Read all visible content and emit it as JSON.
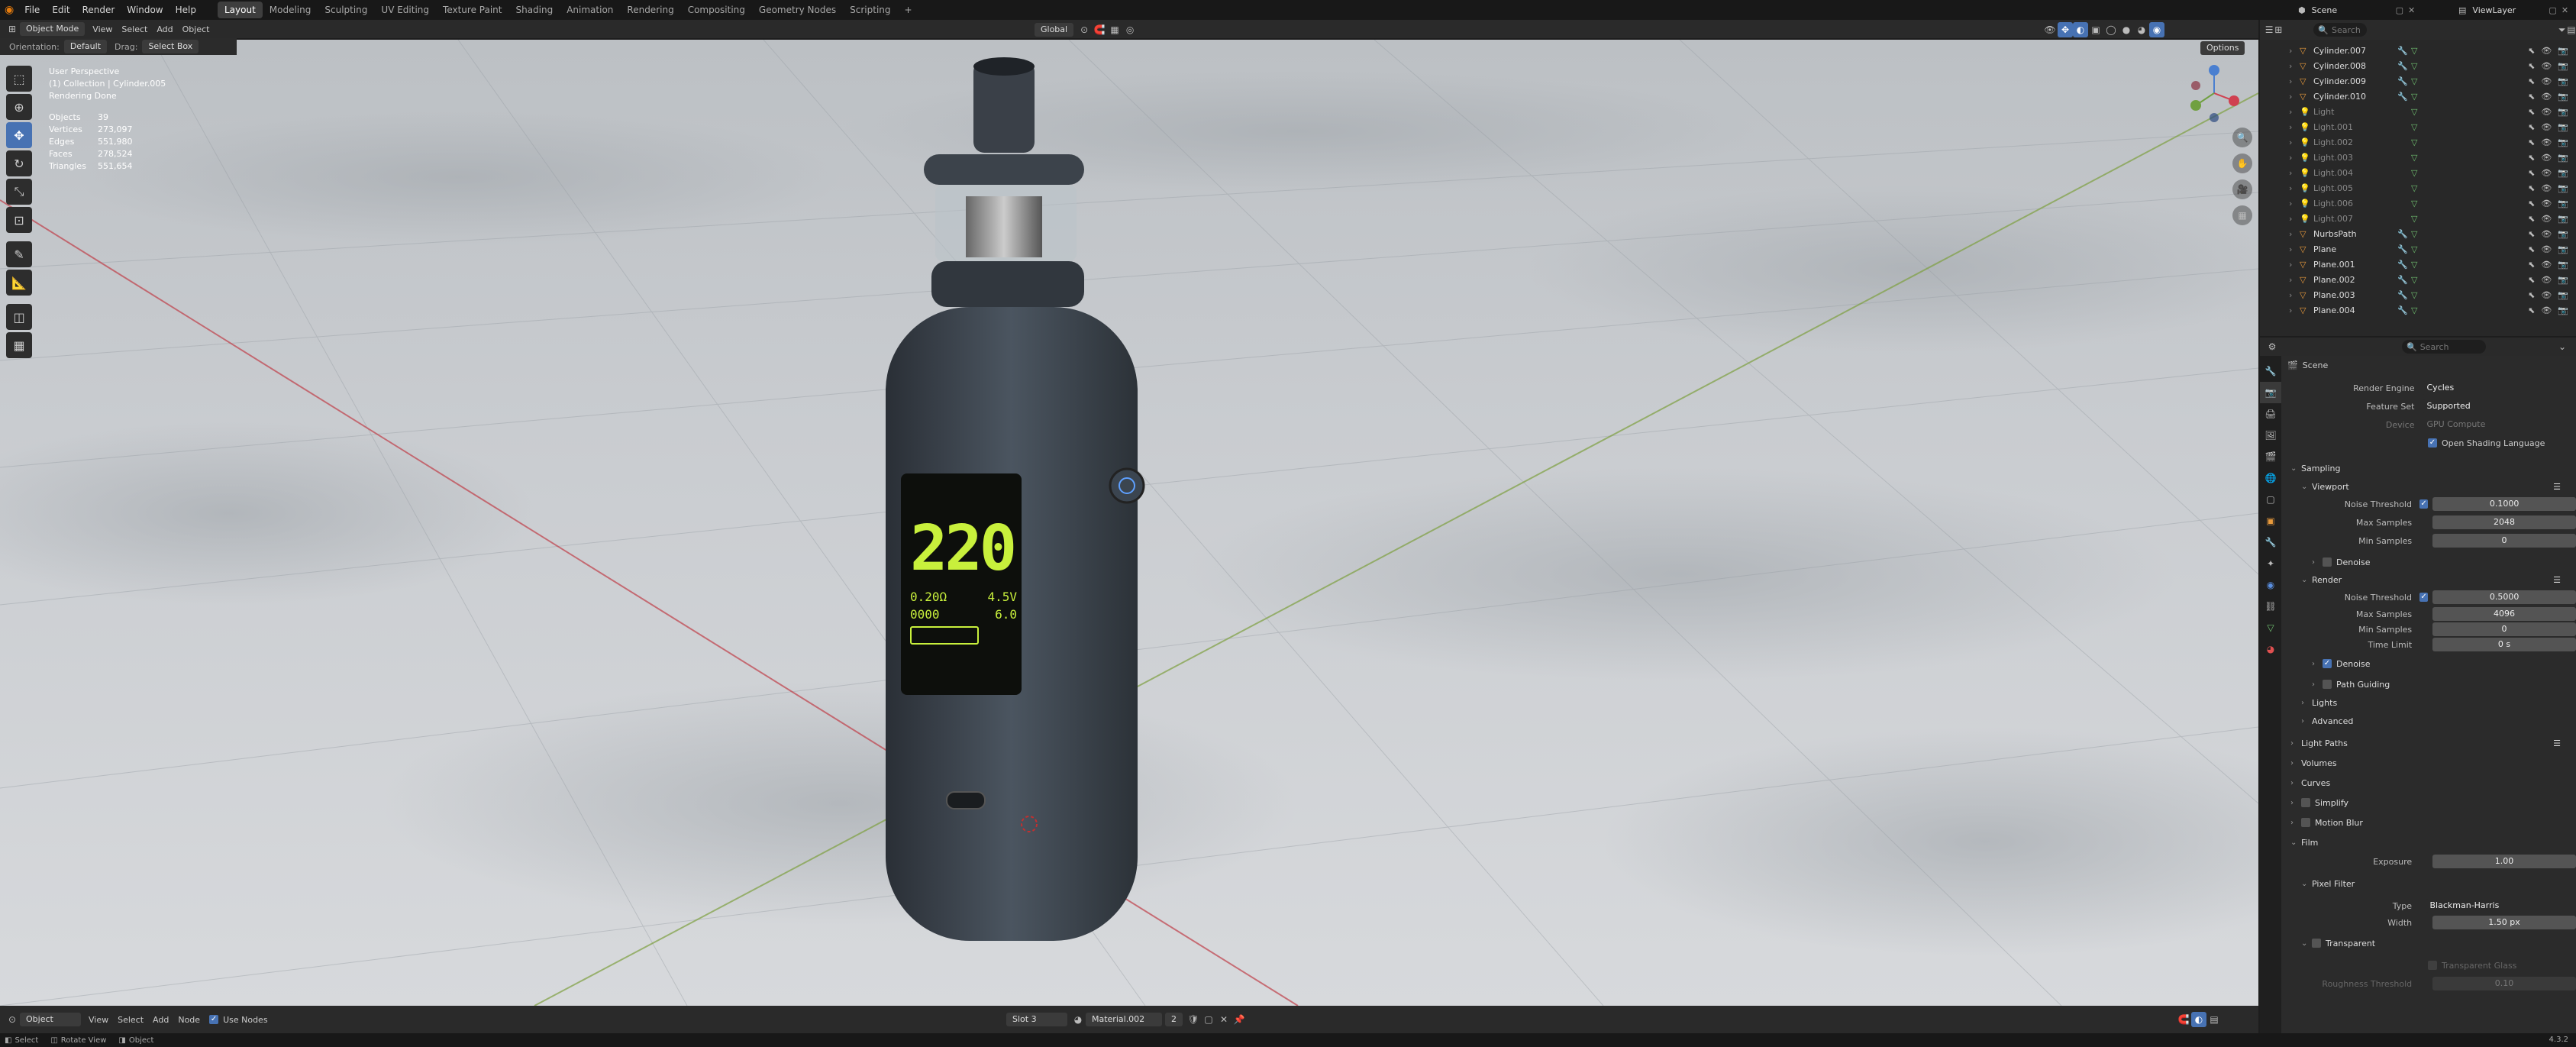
{
  "topbar": {
    "menus": [
      "File",
      "Edit",
      "Render",
      "Window",
      "Help"
    ],
    "workspaces": [
      "Layout",
      "Modeling",
      "Sculpting",
      "UV Editing",
      "Texture Paint",
      "Shading",
      "Animation",
      "Rendering",
      "Compositing",
      "Geometry Nodes",
      "Scripting"
    ],
    "active_workspace": "Layout",
    "scene": "Scene",
    "view_layer": "ViewLayer"
  },
  "viewport_header": {
    "mode": "Object Mode",
    "menus": [
      "View",
      "Select",
      "Add",
      "Object"
    ],
    "orientation_label": "Orientation:",
    "orientation": "Default",
    "drag_label": "Drag:",
    "drag": "Select Box",
    "transform": "Global",
    "options": "Options"
  },
  "viewport_info": {
    "lines": [
      "User Perspective",
      "(1) Collection | Cylinder.005",
      "Rendering Done"
    ],
    "stats": [
      {
        "label": "Objects",
        "value": "39"
      },
      {
        "label": "Vertices",
        "value": "273,097"
      },
      {
        "label": "Edges",
        "value": "551,980"
      },
      {
        "label": "Faces",
        "value": "278,524"
      },
      {
        "label": "Triangles",
        "value": "551,654"
      }
    ]
  },
  "device_screen": {
    "value": "220",
    "row1a": "0.20Ω",
    "row1b": "4.5V",
    "row2a": "0000",
    "row2b": "6.0"
  },
  "outliner": {
    "search_placeholder": "Search",
    "items": [
      {
        "name": "Cylinder.007",
        "light": false
      },
      {
        "name": "Cylinder.008",
        "light": false
      },
      {
        "name": "Cylinder.009",
        "light": false
      },
      {
        "name": "Cylinder.010",
        "light": false
      },
      {
        "name": "Light",
        "light": true
      },
      {
        "name": "Light.001",
        "light": true
      },
      {
        "name": "Light.002",
        "light": true
      },
      {
        "name": "Light.003",
        "light": true
      },
      {
        "name": "Light.004",
        "light": true
      },
      {
        "name": "Light.005",
        "light": true
      },
      {
        "name": "Light.006",
        "light": true
      },
      {
        "name": "Light.007",
        "light": true
      },
      {
        "name": "NurbsPath",
        "light": false
      },
      {
        "name": "Plane",
        "light": false
      },
      {
        "name": "Plane.001",
        "light": false
      },
      {
        "name": "Plane.002",
        "light": false
      },
      {
        "name": "Plane.003",
        "light": false
      },
      {
        "name": "Plane.004",
        "light": false
      }
    ]
  },
  "properties": {
    "search_placeholder": "Search",
    "scene": "Scene",
    "render_engine_label": "Render Engine",
    "render_engine": "Cycles",
    "feature_set_label": "Feature Set",
    "feature_set": "Supported",
    "device_label": "Device",
    "device": "GPU Compute",
    "osl": "Open Shading Language",
    "sampling": "Sampling",
    "viewport": "Viewport",
    "noise_threshold_label": "Noise Threshold",
    "vp_noise": "0.1000",
    "max_samples_label": "Max Samples",
    "vp_max": "2048",
    "min_samples_label": "Min Samples",
    "vp_min": "0",
    "denoise": "Denoise",
    "render": "Render",
    "r_noise": "0.5000",
    "r_max": "4096",
    "r_min": "0",
    "time_limit_label": "Time Limit",
    "time_limit": "0 s",
    "path_guiding": "Path Guiding",
    "lights": "Lights",
    "advanced": "Advanced",
    "light_paths": "Light Paths",
    "volumes": "Volumes",
    "curves": "Curves",
    "simplify": "Simplify",
    "motion_blur": "Motion Blur",
    "film": "Film",
    "exposure_label": "Exposure",
    "exposure": "1.00",
    "pixel_filter": "Pixel Filter",
    "type_label": "Type",
    "filter_type": "Blackman-Harris",
    "width_label": "Width",
    "width": "1.50 px",
    "transparent": "Transparent",
    "transparent_glass": "Transparent Glass",
    "roughness_threshold_label": "Roughness Threshold",
    "roughness_threshold": "0.10"
  },
  "shader_header": {
    "editor": "Object",
    "menus": [
      "View",
      "Select",
      "Add",
      "Node"
    ],
    "use_nodes": "Use Nodes",
    "slot": "Slot 3",
    "material": "Material.002",
    "users": "2"
  },
  "statusbar": {
    "items": [
      "Select",
      "Rotate View",
      "Object"
    ],
    "version": "4.3.2"
  },
  "colors": {
    "accent": "#4772b3",
    "screen_green": "#c8f03c"
  }
}
